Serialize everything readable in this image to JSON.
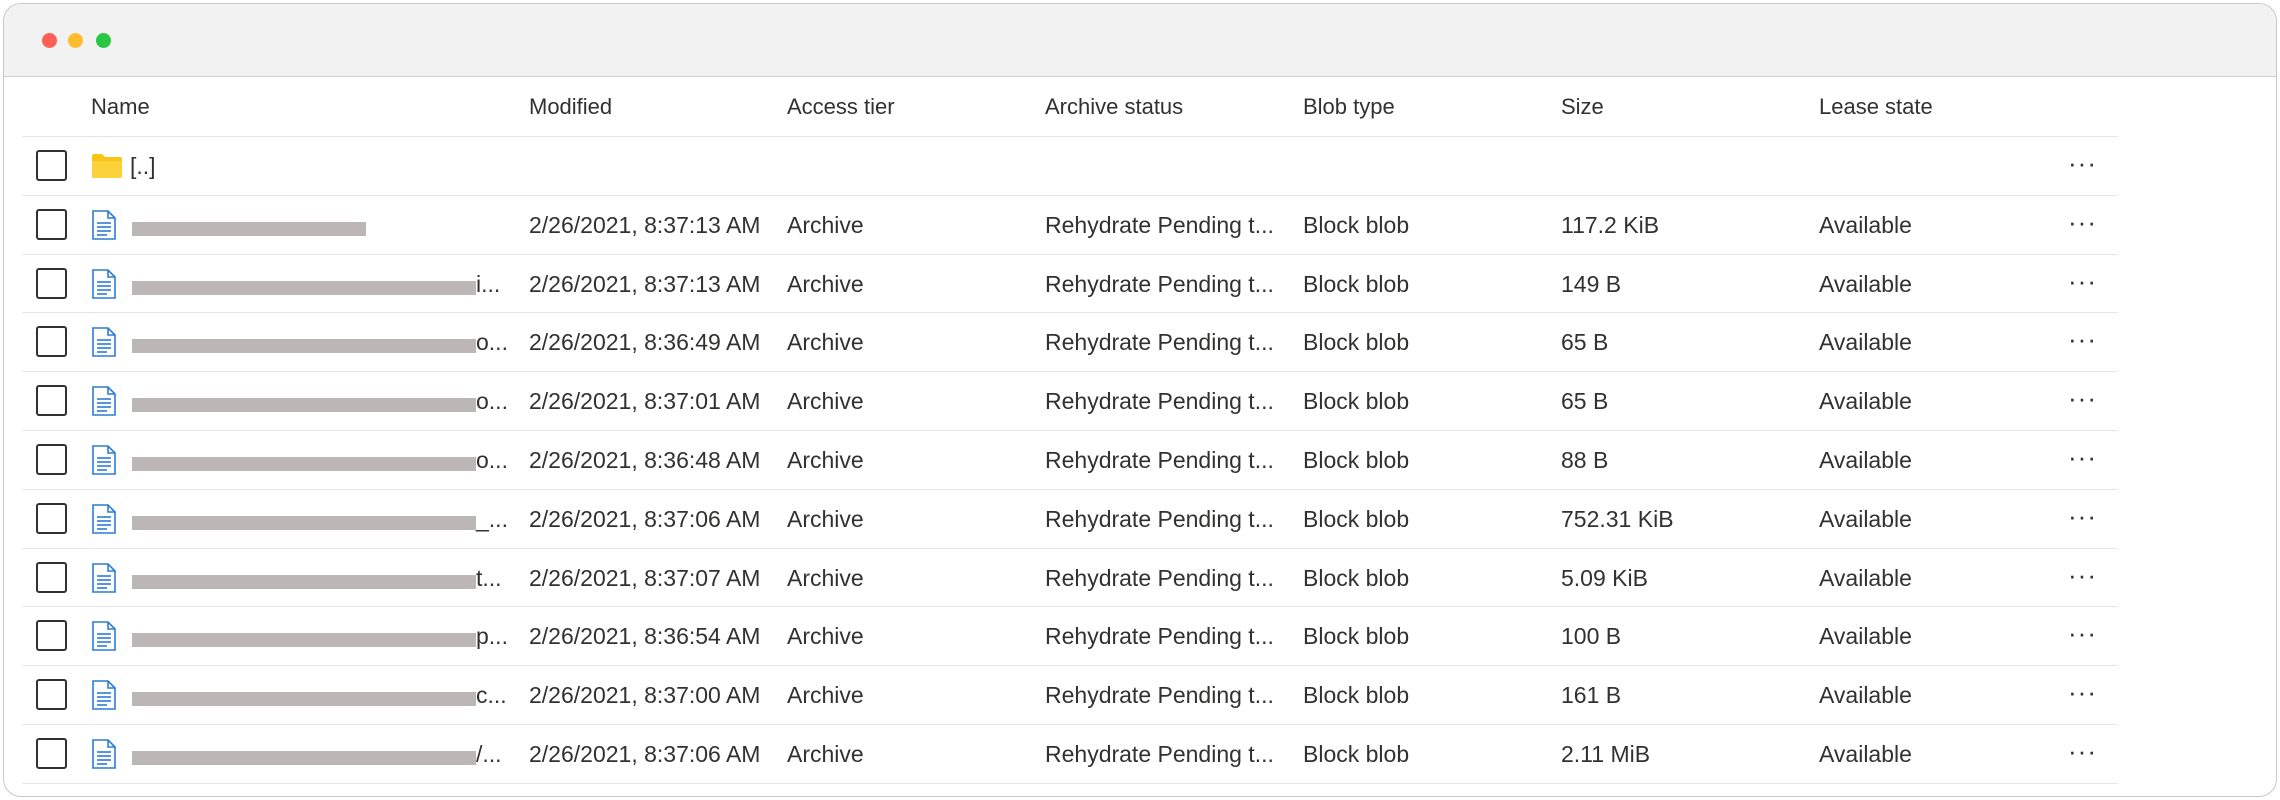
{
  "columns": {
    "name": "Name",
    "modified": "Modified",
    "access_tier": "Access tier",
    "archive_status": "Archive status",
    "blob_type": "Blob type",
    "size": "Size",
    "lease_state": "Lease state"
  },
  "parent_folder": {
    "label": "[..]",
    "icon": "folder-icon",
    "color": "#f8c516"
  },
  "more_label": "···",
  "rows": [
    {
      "name_tail": "",
      "modified": "2/26/2021, 8:37:13 AM",
      "access_tier": "Archive",
      "archive_status": "Rehydrate Pending t...",
      "blob_type": "Block blob",
      "size": "117.2 KiB",
      "lease_state": "Available"
    },
    {
      "name_tail": "i...",
      "modified": "2/26/2021, 8:37:13 AM",
      "access_tier": "Archive",
      "archive_status": "Rehydrate Pending t...",
      "blob_type": "Block blob",
      "size": "149 B",
      "lease_state": "Available"
    },
    {
      "name_tail": "o...",
      "modified": "2/26/2021, 8:36:49 AM",
      "access_tier": "Archive",
      "archive_status": "Rehydrate Pending t...",
      "blob_type": "Block blob",
      "size": "65 B",
      "lease_state": "Available"
    },
    {
      "name_tail": "o...",
      "modified": "2/26/2021, 8:37:01 AM",
      "access_tier": "Archive",
      "archive_status": "Rehydrate Pending t...",
      "blob_type": "Block blob",
      "size": "65 B",
      "lease_state": "Available"
    },
    {
      "name_tail": "o...",
      "modified": "2/26/2021, 8:36:48 AM",
      "access_tier": "Archive",
      "archive_status": "Rehydrate Pending t...",
      "blob_type": "Block blob",
      "size": "88 B",
      "lease_state": "Available"
    },
    {
      "name_tail": "_...",
      "modified": "2/26/2021, 8:37:06 AM",
      "access_tier": "Archive",
      "archive_status": "Rehydrate Pending t...",
      "blob_type": "Block blob",
      "size": "752.31 KiB",
      "lease_state": "Available"
    },
    {
      "name_tail": "t...",
      "modified": "2/26/2021, 8:37:07 AM",
      "access_tier": "Archive",
      "archive_status": "Rehydrate Pending t...",
      "blob_type": "Block blob",
      "size": "5.09 KiB",
      "lease_state": "Available"
    },
    {
      "name_tail": "p...",
      "modified": "2/26/2021, 8:36:54 AM",
      "access_tier": "Archive",
      "archive_status": "Rehydrate Pending t...",
      "blob_type": "Block blob",
      "size": "100 B",
      "lease_state": "Available"
    },
    {
      "name_tail": "c...",
      "modified": "2/26/2021, 8:37:00 AM",
      "access_tier": "Archive",
      "archive_status": "Rehydrate Pending t...",
      "blob_type": "Block blob",
      "size": "161 B",
      "lease_state": "Available"
    },
    {
      "name_tail": "/...",
      "modified": "2/26/2021, 8:37:06 AM",
      "access_tier": "Archive",
      "archive_status": "Rehydrate Pending t...",
      "blob_type": "Block blob",
      "size": "2.11 MiB",
      "lease_state": "Available"
    }
  ],
  "colors": {
    "file_icon": "#2b7cd3",
    "redaction": "#bdb6b6",
    "titlebar": "#f2f2f2"
  }
}
